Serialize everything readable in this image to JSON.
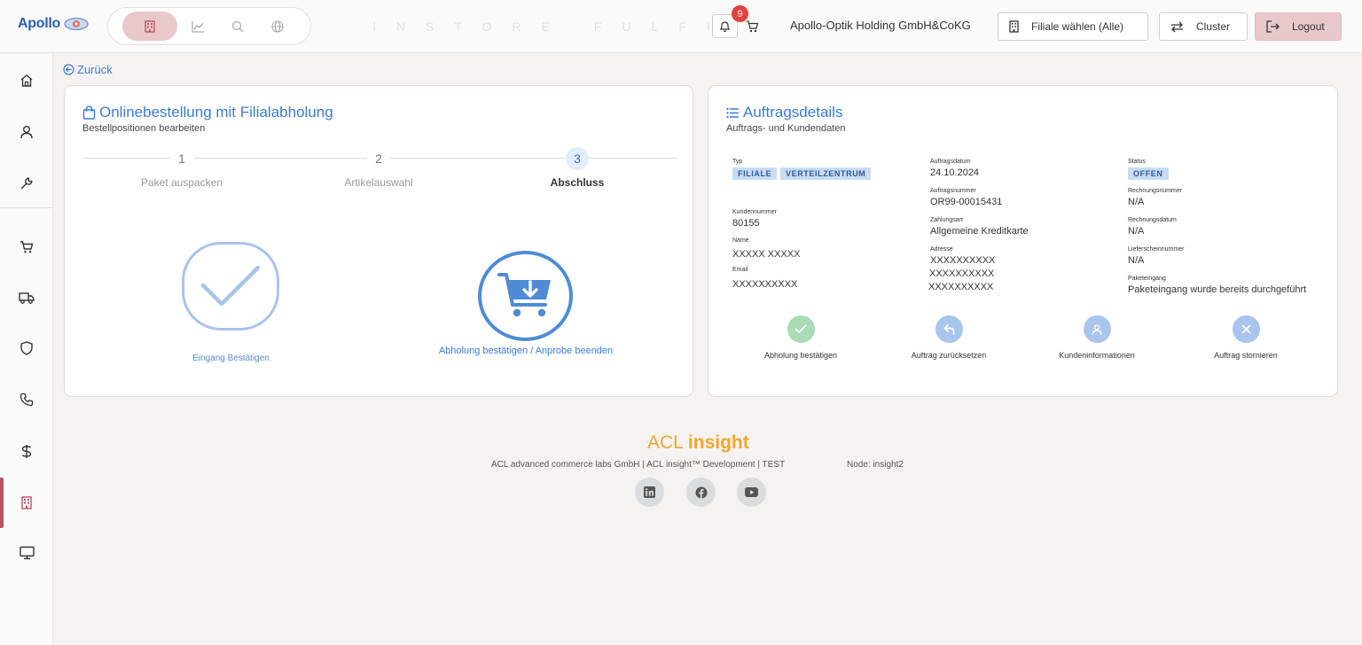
{
  "header": {
    "logo_text": "Apollo",
    "brand_title": "INSTORE FULFILLMENT",
    "notification_count": "9",
    "company": "Apollo-Optik Holding GmbH&CoKG",
    "filiale_label": "Filiale wählen (Alle)",
    "cluster_label": "Cluster",
    "logout_label": "Logout",
    "icons": [
      "store-icon",
      "chart-line-icon",
      "search-icon",
      "globe-icon",
      "bell-icon",
      "cart-icon",
      "building-icon",
      "swap-icon",
      "logout-icon"
    ],
    "accent": "#e9c8cc"
  },
  "sidebar": {
    "items": [
      "home-icon",
      "user-icon",
      "wrench-icon",
      "cart-icon",
      "truck-icon",
      "shield-icon",
      "phone-icon",
      "dollar-icon",
      "store-icon",
      "monitor-icon"
    ],
    "active": "store-icon",
    "active_color": "#b85564"
  },
  "back_label": "Zurück",
  "left_card": {
    "title": "Onlinebestellung mit Filialabholung",
    "subtitle": "Bestellpositionen bearbeiten",
    "steps": [
      {
        "num": "1",
        "label": "Paket auspacken"
      },
      {
        "num": "2",
        "label": "Artikelauswahl"
      },
      {
        "num": "3",
        "label": "Abschluss"
      }
    ],
    "current_step": 3,
    "confirm_label": "Eingang Bestätigen",
    "pickup_label": "Abholung bestätigen / Anprobe beenden"
  },
  "right_card": {
    "title": "Auftragsdetails",
    "subtitle": "Auftrags- und Kundendaten",
    "typ_label": "Typ",
    "typ_tags": [
      "FILIALE",
      "VERTEILZENTRUM"
    ],
    "kundennummer_label": "Kundennummer",
    "kundennummer": "80155",
    "name_label": "Name",
    "name": "XXXXX XXXXX",
    "email_label": "Email",
    "email": "XXXXXXXXXX",
    "auftragsdatum_label": "Auftragsdatum",
    "auftragsdatum": "24.10.2024",
    "auftragsnummer_label": "Auftragsnummer",
    "auftragsnummer": "OR99-00015431",
    "zahlungsart_label": "Zahlungsart",
    "zahlungsart": "Allgemeine Kreditkarte",
    "adresse_label": "Adresse",
    "adresse": [
      "XXXXXXXXXX",
      "XXXXXXXXXX",
      "XXXXXXXXXX"
    ],
    "status_label": "Status",
    "status": "OFFEN",
    "rechnungsnummer_label": "Rechnungsnummer",
    "rechnungsnummer": "N/A",
    "rechnungsdatum_label": "Rechnungsdatum",
    "rechnungsdatum": "N/A",
    "lieferschein_label": "Lieferscheinnummer",
    "lieferschein": "N/A",
    "paketeingang_label": "Paketeingang",
    "paketeingang": "Paketeingang wurde bereits durchgeführt",
    "actions": [
      {
        "label": "Abholung bestätigen",
        "icon": "check-icon",
        "color": "#a9dcb4"
      },
      {
        "label": "Auftrag zurücksetzen",
        "icon": "undo-icon",
        "color": "#a9c5ee"
      },
      {
        "label": "Kundeninformationen",
        "icon": "user-icon",
        "color": "#a9c5ee"
      },
      {
        "label": "Auftrag stornieren",
        "icon": "close-icon",
        "color": "#a9c5ee"
      }
    ]
  },
  "footer": {
    "brand_main": "ACL ",
    "brand_bold": "insight",
    "text": "ACL advanced commerce labs GmbH | ACL insight™ Development | TEST",
    "node": "Node: insight2",
    "social": [
      "linkedin-icon",
      "facebook-icon",
      "youtube-icon"
    ]
  }
}
